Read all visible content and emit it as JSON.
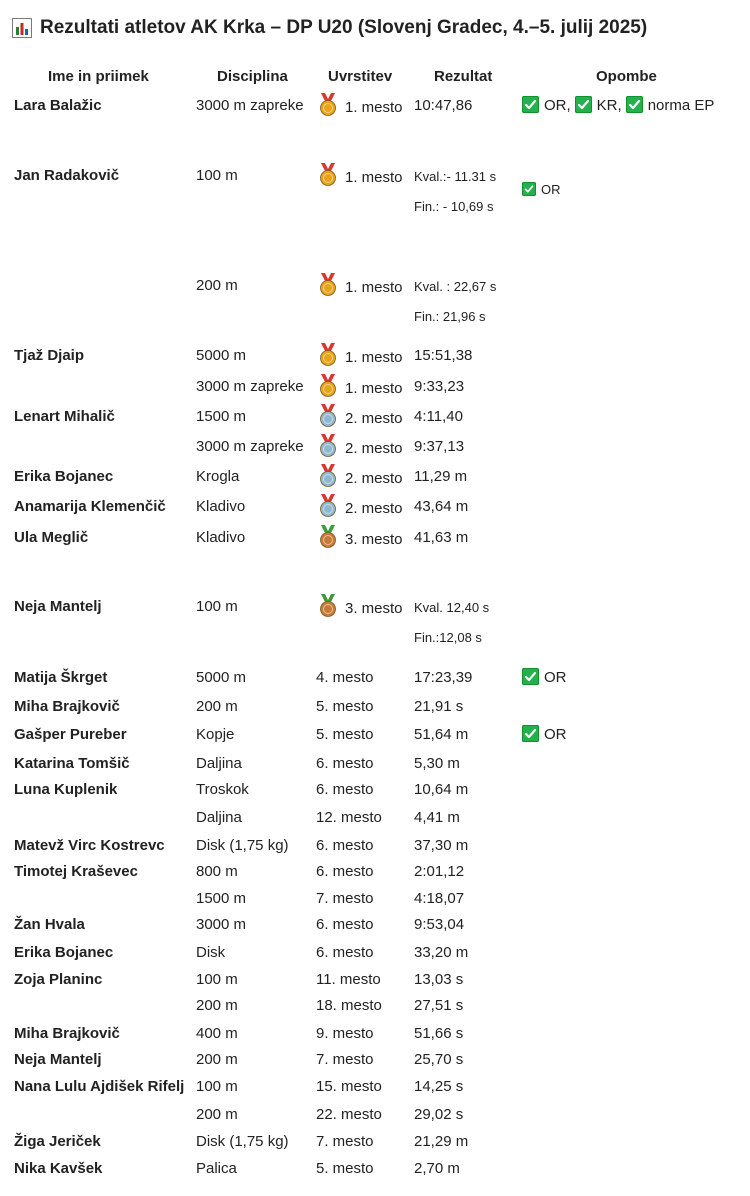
{
  "title": "Rezultati atletov AK Krka – DP U20 (Slovenj Gradec, 4.–5. julij 2025)",
  "columns": {
    "name": "Ime in priimek",
    "discipline": "Disciplina",
    "place": "Uvrstitev",
    "result": "Rezultat",
    "notes": "Opombe"
  },
  "rows": [
    {
      "name": "Lara Balažic",
      "discipline": "3000 m zapreke",
      "medal": "gold",
      "place": "1. mesto",
      "result": "10:47,86",
      "notes": [
        "OR,",
        "KR,",
        "norma EP"
      ]
    },
    {
      "name": "Jan Radakovič",
      "discipline": "100 m",
      "medal": "gold",
      "place": "1. mesto",
      "result_lines": [
        "Kval.:- 11.31 s",
        "Fin.: - 10,69 s"
      ],
      "notes": [
        "OR"
      ]
    },
    {
      "name": "",
      "discipline": "200 m",
      "medal": "gold",
      "place": "1. mesto",
      "result_lines": [
        "Kval. : 22,67 s",
        "Fin.: 21,96 s"
      ],
      "notes": []
    },
    {
      "name": "Tjaž Djaip",
      "discipline": "5000 m",
      "medal": "gold",
      "place": "1. mesto",
      "result": "15:51,38",
      "notes": []
    },
    {
      "name": "",
      "discipline": "3000 m zapreke",
      "medal": "gold",
      "place": "1. mesto",
      "result": "9:33,23",
      "notes": []
    },
    {
      "name": "Lenart Mihalič",
      "discipline": "1500 m",
      "medal": "silver",
      "place": "2. mesto",
      "result": "4:11,40",
      "notes": []
    },
    {
      "name": "",
      "discipline": "3000 m zapreke",
      "medal": "silver",
      "place": "2. mesto",
      "result": "9:37,13",
      "notes": []
    },
    {
      "name": "Erika Bojanec",
      "discipline": "Krogla",
      "medal": "silver",
      "place": "2. mesto",
      "result": "11,29 m",
      "notes": []
    },
    {
      "name": "Anamarija Klemenčič",
      "discipline": "Kladivo",
      "medal": "silver",
      "place": "2. mesto",
      "result": "43,64 m",
      "notes": []
    },
    {
      "name": "Ula Meglič",
      "discipline": "Kladivo",
      "medal": "bronze",
      "place": "3. mesto",
      "result": "41,63 m",
      "notes": []
    },
    {
      "name": "Neja Mantelj",
      "discipline": "100 m",
      "medal": "bronze",
      "place": "3. mesto",
      "result_lines": [
        "Kval. 12,40 s",
        "Fin.:12,08 s"
      ],
      "notes": []
    },
    {
      "name": "Matija Škrget",
      "discipline": "5000 m",
      "medal": "",
      "place": "4. mesto",
      "result": "17:23,39",
      "notes": [
        "OR"
      ]
    },
    {
      "name": "Miha Brajkovič",
      "discipline": "200 m",
      "medal": "",
      "place": "5. mesto",
      "result": "21,91 s",
      "notes": []
    },
    {
      "name": "Gašper Pureber",
      "discipline": "Kopje",
      "medal": "",
      "place": "5. mesto",
      "result": "51,64 m",
      "notes": [
        "OR"
      ]
    },
    {
      "name": "Katarina Tomšič",
      "discipline": "Daljina",
      "medal": "",
      "place": "6. mesto",
      "result": "5,30 m",
      "notes": []
    },
    {
      "name": "Luna Kuplenik",
      "discipline": "Troskok",
      "medal": "",
      "place": "6. mesto",
      "result": "10,64 m",
      "notes": []
    },
    {
      "name": "",
      "discipline": "Daljina",
      "medal": "",
      "place": "12. mesto",
      "result": "4,41 m",
      "notes": []
    },
    {
      "name": "Matevž Virc Kostrevc",
      "discipline": "Disk (1,75 kg)",
      "medal": "",
      "place": "6. mesto",
      "result": "37,30 m",
      "notes": []
    },
    {
      "name": "Timotej Kraševec",
      "discipline": "800 m",
      "medal": "",
      "place": "6. mesto",
      "result": "2:01,12",
      "notes": []
    },
    {
      "name": "",
      "discipline": "1500 m",
      "medal": "",
      "place": "7. mesto",
      "result": "4:18,07",
      "notes": []
    },
    {
      "name": "Žan Hvala",
      "discipline": "3000 m",
      "medal": "",
      "place": "6. mesto",
      "result": "9:53,04",
      "notes": []
    },
    {
      "name": "Erika Bojanec",
      "discipline": "Disk",
      "medal": "",
      "place": "6. mesto",
      "result": "33,20 m",
      "notes": []
    },
    {
      "name": "Zoja Planinc",
      "discipline": "100 m",
      "medal": "",
      "place": "11. mesto",
      "result": "13,03 s",
      "notes": []
    },
    {
      "name": "",
      "discipline": "200 m",
      "medal": "",
      "place": "18. mesto",
      "result": "27,51 s",
      "notes": []
    },
    {
      "name": "Miha Brajkovič",
      "discipline": "400 m",
      "medal": "",
      "place": "9. mesto",
      "result": "51,66 s",
      "notes": []
    },
    {
      "name": "Neja Mantelj",
      "discipline": "200 m",
      "medal": "",
      "place": "7. mesto",
      "result": "25,70 s",
      "notes": []
    },
    {
      "name": "Nana Lulu Ajdišek Rifelj",
      "discipline": "100 m",
      "medal": "",
      "place": "15. mesto",
      "result": "14,25 s",
      "notes": []
    },
    {
      "name": "",
      "discipline": "200 m",
      "medal": "",
      "place": "22. mesto",
      "result": "29,02 s",
      "notes": []
    },
    {
      "name": "Žiga Jeriček",
      "discipline": "Disk (1,75 kg)",
      "medal": "",
      "place": "7. mesto",
      "result": "21,29 m",
      "notes": []
    },
    {
      "name": "Nika Kavšek",
      "discipline": "Palica",
      "medal": "",
      "place": "5. mesto",
      "result": "2,70 m",
      "notes": []
    }
  ],
  "colors": {
    "gold": "#e8a317",
    "silver": "#8fb7cf",
    "bronze": "#c77a35",
    "check": "#22b14c",
    "ribbon_red": "#d9382f",
    "ribbon_green": "#3f9a3a"
  }
}
